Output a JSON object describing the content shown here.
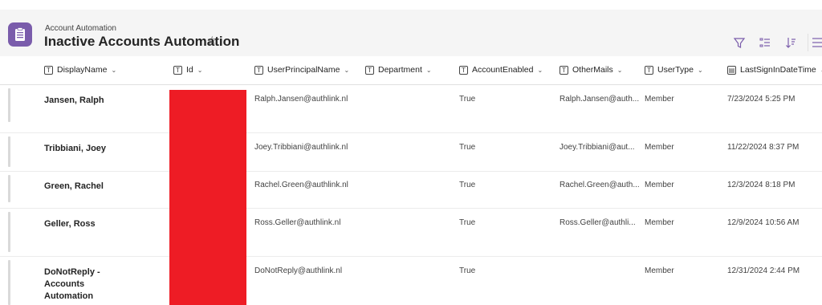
{
  "header": {
    "subtitle": "Account Automation",
    "title": "Inactive Accounts Automation",
    "star": "☆"
  },
  "colors": {
    "accent": "#7a5cab",
    "redaction": "#ee1c25"
  },
  "toolbar": {
    "icons": [
      "filter-icon",
      "group-by-icon",
      "sort-icon",
      "view-options-icon"
    ]
  },
  "columns": [
    {
      "label": "DisplayName"
    },
    {
      "label": "Id"
    },
    {
      "label": "UserPrincipalName"
    },
    {
      "label": "Department"
    },
    {
      "label": "AccountEnabled"
    },
    {
      "label": "OtherMails"
    },
    {
      "label": "UserType"
    },
    {
      "label": "LastSignInDateTime"
    }
  ],
  "rows": [
    {
      "name": "Jansen, Ralph",
      "upn": "Ralph.Jansen@authlink.nl",
      "enabled": "True",
      "othermails": "Ralph.Jansen@auth...",
      "usertype": "Member",
      "lastsignin": "7/23/2024 5:25 PM"
    },
    {
      "name": "Tribbiani, Joey",
      "upn": "Joey.Tribbiani@authlink.nl",
      "enabled": "True",
      "othermails": "Joey.Tribbiani@aut...",
      "usertype": "Member",
      "lastsignin": "11/22/2024 8:37 PM"
    },
    {
      "name": "Green, Rachel",
      "upn": "Rachel.Green@authlink.nl",
      "enabled": "True",
      "othermails": "Rachel.Green@auth...",
      "usertype": "Member",
      "lastsignin": "12/3/2024 8:18 PM"
    },
    {
      "name": "Geller, Ross",
      "upn": "Ross.Geller@authlink.nl",
      "enabled": "True",
      "othermails": "Ross.Geller@authli...",
      "usertype": "Member",
      "lastsignin": "12/9/2024 10:56 AM"
    },
    {
      "name": "DoNotReply - Accounts Automation",
      "upn": "DoNotReply@authlink.nl",
      "enabled": "True",
      "othermails": "",
      "usertype": "Member",
      "lastsignin": "12/31/2024 2:44 PM"
    }
  ]
}
